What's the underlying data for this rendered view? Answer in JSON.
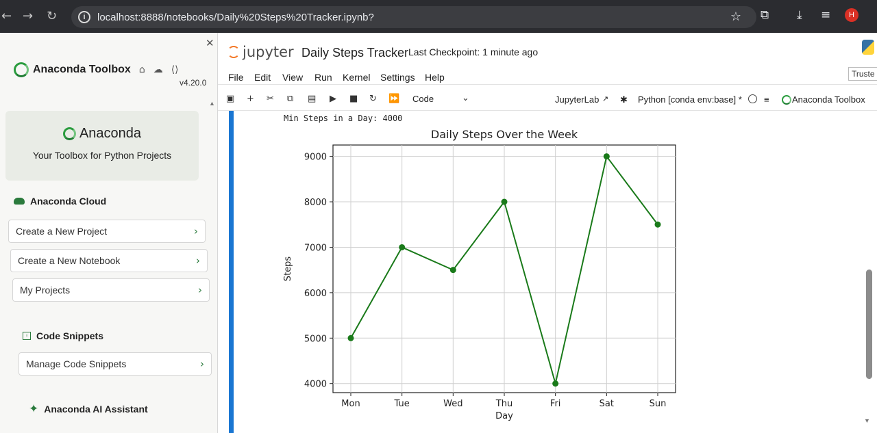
{
  "browser": {
    "url": "localhost:8888/notebooks/Daily%20Steps%20Tracker.ipynb?",
    "profile_initial": "H"
  },
  "sidebar": {
    "title": "Anaconda Toolbox",
    "version": "v4.20.0",
    "brand": {
      "name": "Anaconda",
      "tagline": "Your Toolbox for Python Projects"
    },
    "cloud_section": "Anaconda Cloud",
    "cloud_buttons": [
      "Create a New Project",
      "Create a New Notebook",
      "My Projects"
    ],
    "snippets_section": "Code Snippets",
    "snippets_button": "Manage Code Snippets",
    "ai_section": "Anaconda AI Assistant"
  },
  "notebook": {
    "logo_text": "jupyter",
    "title": "Daily Steps Tracker",
    "checkpoint": "Last Checkpoint: 1 minute ago",
    "menu": [
      "File",
      "Edit",
      "View",
      "Run",
      "Kernel",
      "Settings",
      "Help"
    ],
    "trusted": "Truste",
    "cell_type": "Code",
    "jupyterlab_label": "JupyterLab",
    "kernel_label": "Python [conda env:base] *",
    "toolbox_label": "Anaconda Toolbox",
    "output_text": "Min Steps in a Day: 4000"
  },
  "colors": {
    "line": "#1a7a1a",
    "accent_blue": "#1976d2",
    "anaconda_green": "#2a9c3e"
  },
  "chart_data": {
    "type": "line",
    "title": "Daily Steps Over the Week",
    "xlabel": "Day",
    "ylabel": "Steps",
    "categories": [
      "Mon",
      "Tue",
      "Wed",
      "Thu",
      "Fri",
      "Sat",
      "Sun"
    ],
    "values": [
      5000,
      7000,
      6500,
      8000,
      4000,
      9000,
      7500
    ],
    "yticks": [
      4000,
      5000,
      6000,
      7000,
      8000,
      9000
    ],
    "ylim": [
      3800,
      9250
    ],
    "grid": true,
    "marker": "o"
  }
}
